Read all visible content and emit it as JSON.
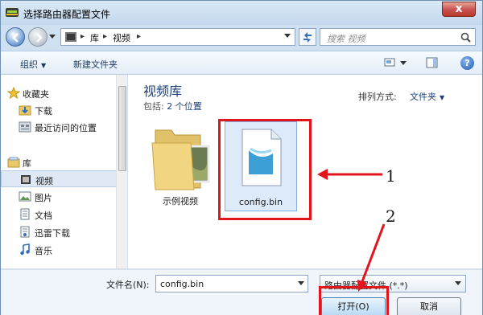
{
  "window": {
    "title": "选择路由器配置文件",
    "close_glyph": "x"
  },
  "address_bar": {
    "crumbs": [
      "库",
      "视频"
    ],
    "search_placeholder": "搜索 视频"
  },
  "toolbar": {
    "organize_label": "组织",
    "new_folder_label": "新建文件夹"
  },
  "nav_pane": {
    "favorites_label": "收藏夹",
    "favorites": [
      {
        "label": "下载",
        "icon": "download-folder-icon"
      },
      {
        "label": "最近访问的位置",
        "icon": "recent-places-icon"
      }
    ],
    "libraries_label": "库",
    "libraries": [
      {
        "label": "视频",
        "icon": "video-library-icon",
        "selected": true
      },
      {
        "label": "图片",
        "icon": "pictures-library-icon"
      },
      {
        "label": "文档",
        "icon": "documents-library-icon"
      },
      {
        "label": "迅雷下载",
        "icon": "thunder-download-icon"
      },
      {
        "label": "音乐",
        "icon": "music-library-icon"
      }
    ]
  },
  "file_pane": {
    "library_title": "视频库",
    "includes_prefix": "包括:",
    "includes_link": "2 个位置",
    "arrange_label": "排列方式:",
    "arrange_value": "文件夹",
    "items": [
      {
        "label": "示例视频",
        "type": "folder"
      },
      {
        "label": "config.bin",
        "type": "file",
        "selected": true
      }
    ]
  },
  "annotations": {
    "step1": "1",
    "step2": "2",
    "highlight_color": "#e2141c"
  },
  "bottom": {
    "filename_label": "文件名(N):",
    "filename_value": "config.bin",
    "filetype_value": "路由器配置文件 (*.*)",
    "open_label": "打开(O)",
    "cancel_label": "取消"
  },
  "colors": {
    "accent": "#1e3f7a",
    "title_bar": "#c2d7ee"
  }
}
